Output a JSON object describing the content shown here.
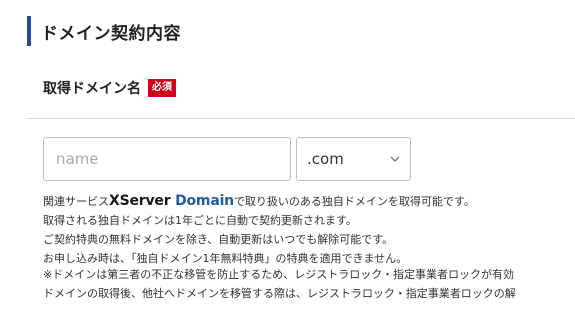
{
  "section": {
    "title": "ドメイン契約内容"
  },
  "field": {
    "label": "取得ドメイン名",
    "required_badge": "必須",
    "name_placeholder": "name",
    "tld_value": ".com"
  },
  "info": {
    "line1_prefix": "関連サービス",
    "brand_x": "XServer",
    "brand_domain": "Domain",
    "line1_suffix": "で取り扱いのある独自ドメインを取得可能です。",
    "line2": "取得される独自ドメインは1年ごとに自動で契約更新されます。",
    "line3": "ご契約特典の無料ドメインを除き、自動更新はいつでも解除可能です。",
    "line4": "お申し込み時は、「独自ドメイン1年無料特典」の特典を適用できません。"
  },
  "notes": {
    "line1": "※ドメインは第三者の不正な移管を防止するため、レジストラロック・指定事業者ロックが有効",
    "line2": "ドメインの取得後、他社へドメインを移管する際は、レジストラロック・指定事業者ロックの解"
  },
  "colors": {
    "accent": "#1f4f9c",
    "required": "#d0021b",
    "brand_domain": "#1f5ba8"
  },
  "icons": {
    "select_arrow": "chevron-down-icon"
  }
}
